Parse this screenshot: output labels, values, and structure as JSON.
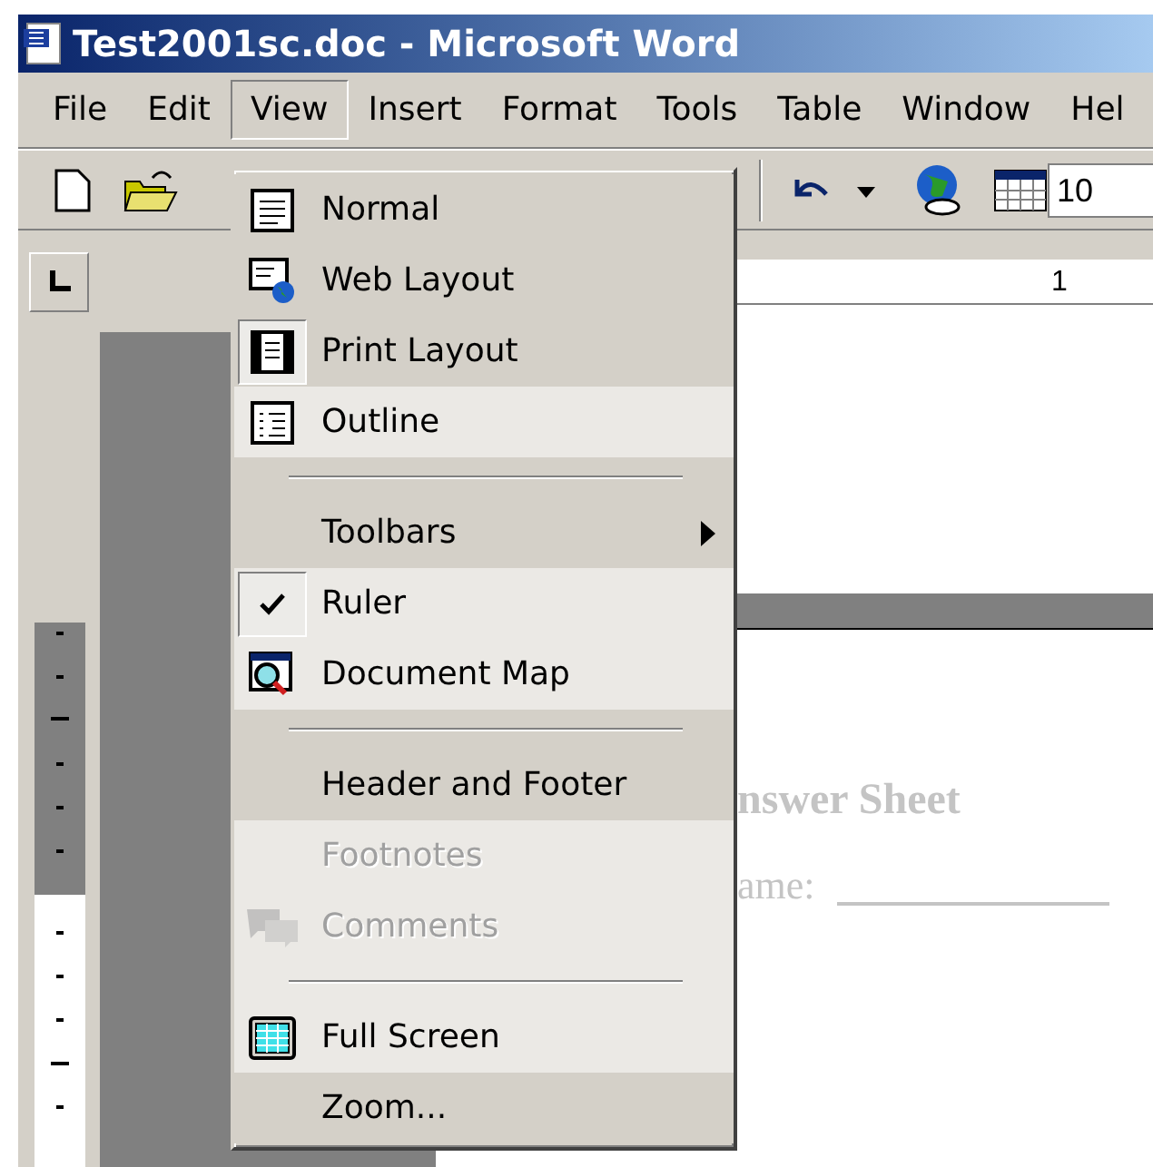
{
  "window": {
    "title": "Test2001sc.doc - Microsoft Word"
  },
  "menu_bar": [
    {
      "label": "File",
      "selected": false
    },
    {
      "label": "Edit",
      "selected": false
    },
    {
      "label": "View",
      "selected": true
    },
    {
      "label": "Insert",
      "selected": false
    },
    {
      "label": "Format",
      "selected": false
    },
    {
      "label": "Tools",
      "selected": false
    },
    {
      "label": "Table",
      "selected": false
    },
    {
      "label": "Window",
      "selected": false
    },
    {
      "label": "Hel",
      "selected": false
    }
  ],
  "toolbar": {
    "font_size": "10"
  },
  "view_menu": {
    "items": [
      {
        "kind": "item",
        "label": "Normal",
        "checked": false,
        "disabled": false,
        "has_submenu": false,
        "rarely_used": false
      },
      {
        "kind": "item",
        "label": "Web Layout",
        "checked": false,
        "disabled": false,
        "has_submenu": false,
        "rarely_used": false
      },
      {
        "kind": "item",
        "label": "Print Layout",
        "checked": true,
        "disabled": false,
        "has_submenu": false,
        "rarely_used": false
      },
      {
        "kind": "item",
        "label": "Outline",
        "checked": false,
        "disabled": false,
        "has_submenu": false,
        "rarely_used": true
      },
      {
        "kind": "separator",
        "rarely_used": false
      },
      {
        "kind": "item",
        "label": "Toolbars",
        "checked": false,
        "disabled": false,
        "has_submenu": true,
        "rarely_used": false
      },
      {
        "kind": "item",
        "label": "Ruler",
        "checked": true,
        "disabled": false,
        "has_submenu": false,
        "rarely_used": true
      },
      {
        "kind": "item",
        "label": "Document Map",
        "checked": false,
        "disabled": false,
        "has_submenu": false,
        "rarely_used": true
      },
      {
        "kind": "separator",
        "rarely_used": false
      },
      {
        "kind": "item",
        "label": "Header and Footer",
        "checked": false,
        "disabled": false,
        "has_submenu": false,
        "rarely_used": false
      },
      {
        "kind": "item",
        "label": "Footnotes",
        "checked": false,
        "disabled": true,
        "has_submenu": false,
        "rarely_used": true
      },
      {
        "kind": "item",
        "label": "Comments",
        "checked": false,
        "disabled": true,
        "has_submenu": false,
        "rarely_used": true
      },
      {
        "kind": "separator",
        "rarely_used": true
      },
      {
        "kind": "item",
        "label": "Full Screen",
        "checked": false,
        "disabled": false,
        "has_submenu": false,
        "rarely_used": true
      },
      {
        "kind": "item",
        "label": "Zoom...",
        "checked": false,
        "disabled": false,
        "has_submenu": false,
        "rarely_used": false
      }
    ]
  },
  "document": {
    "ruler_label": "1",
    "heading": "nswer Sheet",
    "field_label": "ame:"
  }
}
